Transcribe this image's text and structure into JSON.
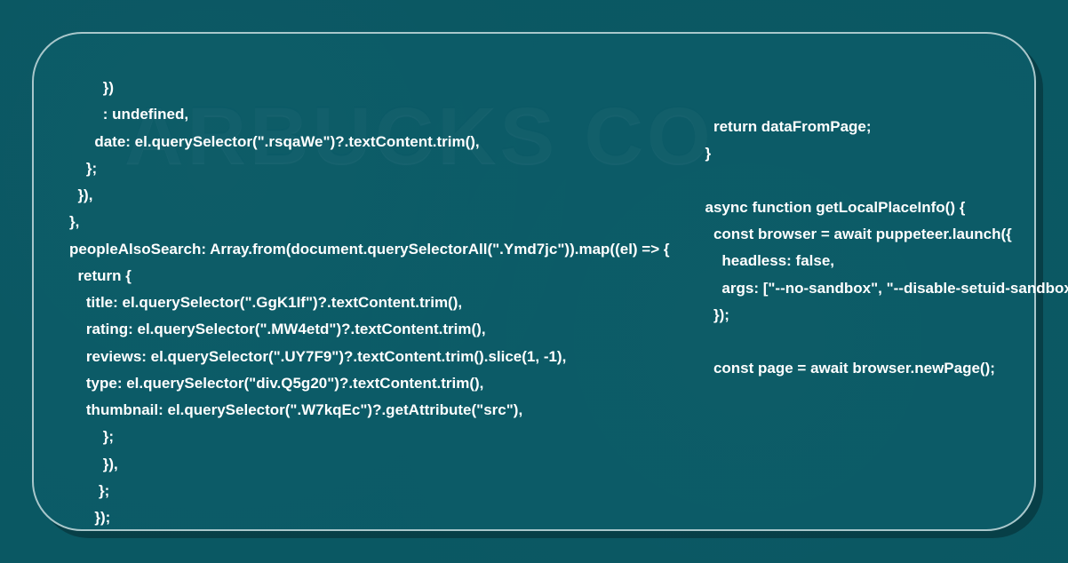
{
  "background_sign": "ARBUCKS CO",
  "code": {
    "left": "        })\n        : undefined,\n      date: el.querySelector(\".rsqaWe\")?.textContent.trim(),\n    };\n  }),\n},\npeopleAlsoSearch: Array.from(document.querySelectorAll(\".Ymd7jc\")).map((el) => {\n  return {\n    title: el.querySelector(\".GgK1If\")?.textContent.trim(),\n    rating: el.querySelector(\".MW4etd\")?.textContent.trim(),\n    reviews: el.querySelector(\".UY7F9\")?.textContent.trim().slice(1, -1),\n    type: el.querySelector(\"div.Q5g20\")?.textContent.trim(),\n    thumbnail: el.querySelector(\".W7kqEc\")?.getAttribute(\"src\"),\n        };\n        }),\n       };\n      });",
    "right": "  return dataFromPage;\n}\n\nasync function getLocalPlaceInfo() {\n  const browser = await puppeteer.launch({\n    headless: false,\n    args: [\"--no-sandbox\", \"--disable-setuid-sandbox\"],\n  });\n\n  const page = await browser.newPage();"
  }
}
